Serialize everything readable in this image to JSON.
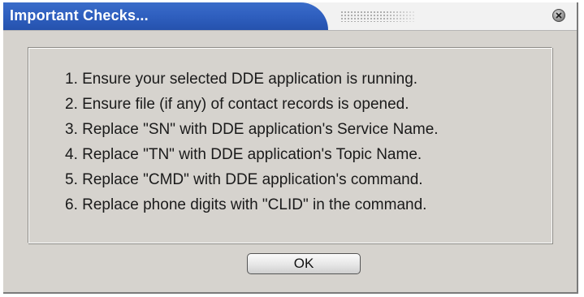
{
  "dialog": {
    "title": "Important Checks...",
    "close_icon": "close-icon",
    "checks": [
      "1. Ensure your selected DDE application  is running.",
      "2. Ensure file (if any)  of contact records is opened.",
      "3. Replace \"SN\" with DDE application's Service Name.",
      "4. Replace \"TN\" with DDE application's Topic Name.",
      "5. Replace \"CMD\" with DDE application's command.",
      "6. Replace phone digits with \"CLID\" in the command."
    ],
    "ok_label": "OK"
  },
  "colors": {
    "title_bar": "#2f5fbf",
    "dialog_bg": "#d6d3ce",
    "title_text": "#ffffff"
  }
}
